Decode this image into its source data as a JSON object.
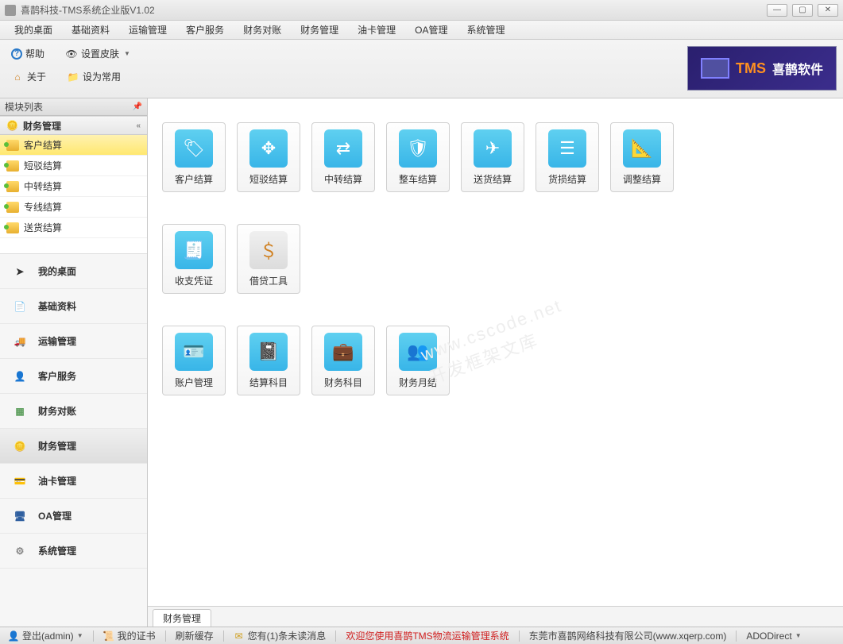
{
  "window": {
    "title": "喜鹊科技-TMS系统企业版V1.02"
  },
  "menubar": [
    "我的桌面",
    "基础资料",
    "运输管理",
    "客户服务",
    "财务对账",
    "财务管理",
    "油卡管理",
    "OA管理",
    "系统管理"
  ],
  "toolbar": {
    "help": "帮助",
    "skin": "设置皮肤",
    "about": "关于",
    "set_default": "设为常用"
  },
  "brand": {
    "tms": "TMS",
    "cn": "喜鹊软件"
  },
  "left": {
    "panel_title": "模块列表",
    "section_title": "财务管理",
    "tree": [
      "客户结算",
      "短驳结算",
      "中转结算",
      "专线结算",
      "送货结算"
    ],
    "tree_selected": 0,
    "nav": [
      "我的桌面",
      "基础资料",
      "运输管理",
      "客户服务",
      "财务对账",
      "财务管理",
      "油卡管理",
      "OA管理",
      "系统管理"
    ],
    "nav_active": 5
  },
  "tiles": {
    "row1": [
      "客户结算",
      "短驳结算",
      "中转结算",
      "整车结算",
      "送货结算",
      "货损结算",
      "调整结算"
    ],
    "row2": [
      "收支凭证",
      "借贷工具"
    ],
    "row3": [
      "账户管理",
      "结算科目",
      "财务科目",
      "财务月结"
    ]
  },
  "content_tab": "财务管理",
  "statusbar": {
    "login": "登出(admin)",
    "cert": "我的证书",
    "refresh": "刷新缓存",
    "unread": "您有(1)条未读消息",
    "welcome": "欢迎您使用喜鹊TMS物流运输管理系统",
    "company": "东莞市喜鹊网络科技有限公司(www.xqerp.com)",
    "conn": "ADODirect"
  },
  "watermark": "www.cscode.net\n开发框架文库"
}
